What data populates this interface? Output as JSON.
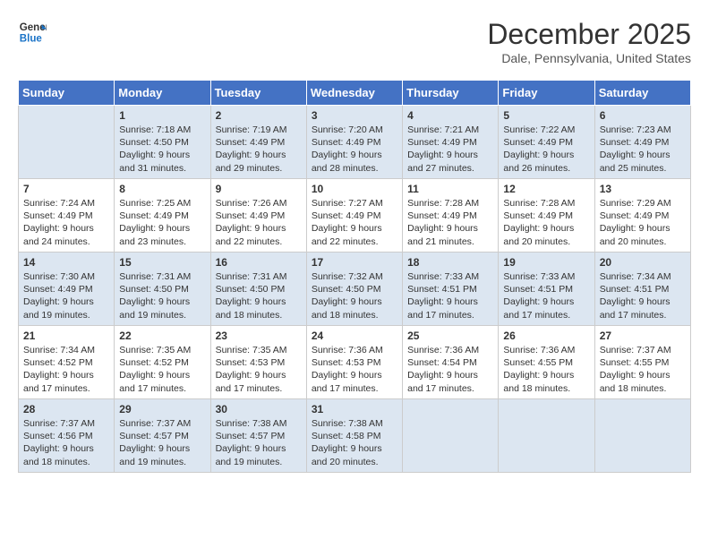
{
  "header": {
    "logo_line1": "General",
    "logo_line2": "Blue",
    "month": "December 2025",
    "location": "Dale, Pennsylvania, United States"
  },
  "days_of_week": [
    "Sunday",
    "Monday",
    "Tuesday",
    "Wednesday",
    "Thursday",
    "Friday",
    "Saturday"
  ],
  "weeks": [
    [
      {
        "day": "",
        "content": ""
      },
      {
        "day": "1",
        "content": "Sunrise: 7:18 AM\nSunset: 4:50 PM\nDaylight: 9 hours\nand 31 minutes."
      },
      {
        "day": "2",
        "content": "Sunrise: 7:19 AM\nSunset: 4:49 PM\nDaylight: 9 hours\nand 29 minutes."
      },
      {
        "day": "3",
        "content": "Sunrise: 7:20 AM\nSunset: 4:49 PM\nDaylight: 9 hours\nand 28 minutes."
      },
      {
        "day": "4",
        "content": "Sunrise: 7:21 AM\nSunset: 4:49 PM\nDaylight: 9 hours\nand 27 minutes."
      },
      {
        "day": "5",
        "content": "Sunrise: 7:22 AM\nSunset: 4:49 PM\nDaylight: 9 hours\nand 26 minutes."
      },
      {
        "day": "6",
        "content": "Sunrise: 7:23 AM\nSunset: 4:49 PM\nDaylight: 9 hours\nand 25 minutes."
      }
    ],
    [
      {
        "day": "7",
        "content": "Sunrise: 7:24 AM\nSunset: 4:49 PM\nDaylight: 9 hours\nand 24 minutes."
      },
      {
        "day": "8",
        "content": "Sunrise: 7:25 AM\nSunset: 4:49 PM\nDaylight: 9 hours\nand 23 minutes."
      },
      {
        "day": "9",
        "content": "Sunrise: 7:26 AM\nSunset: 4:49 PM\nDaylight: 9 hours\nand 22 minutes."
      },
      {
        "day": "10",
        "content": "Sunrise: 7:27 AM\nSunset: 4:49 PM\nDaylight: 9 hours\nand 22 minutes."
      },
      {
        "day": "11",
        "content": "Sunrise: 7:28 AM\nSunset: 4:49 PM\nDaylight: 9 hours\nand 21 minutes."
      },
      {
        "day": "12",
        "content": "Sunrise: 7:28 AM\nSunset: 4:49 PM\nDaylight: 9 hours\nand 20 minutes."
      },
      {
        "day": "13",
        "content": "Sunrise: 7:29 AM\nSunset: 4:49 PM\nDaylight: 9 hours\nand 20 minutes."
      }
    ],
    [
      {
        "day": "14",
        "content": "Sunrise: 7:30 AM\nSunset: 4:49 PM\nDaylight: 9 hours\nand 19 minutes."
      },
      {
        "day": "15",
        "content": "Sunrise: 7:31 AM\nSunset: 4:50 PM\nDaylight: 9 hours\nand 19 minutes."
      },
      {
        "day": "16",
        "content": "Sunrise: 7:31 AM\nSunset: 4:50 PM\nDaylight: 9 hours\nand 18 minutes."
      },
      {
        "day": "17",
        "content": "Sunrise: 7:32 AM\nSunset: 4:50 PM\nDaylight: 9 hours\nand 18 minutes."
      },
      {
        "day": "18",
        "content": "Sunrise: 7:33 AM\nSunset: 4:51 PM\nDaylight: 9 hours\nand 17 minutes."
      },
      {
        "day": "19",
        "content": "Sunrise: 7:33 AM\nSunset: 4:51 PM\nDaylight: 9 hours\nand 17 minutes."
      },
      {
        "day": "20",
        "content": "Sunrise: 7:34 AM\nSunset: 4:51 PM\nDaylight: 9 hours\nand 17 minutes."
      }
    ],
    [
      {
        "day": "21",
        "content": "Sunrise: 7:34 AM\nSunset: 4:52 PM\nDaylight: 9 hours\nand 17 minutes."
      },
      {
        "day": "22",
        "content": "Sunrise: 7:35 AM\nSunset: 4:52 PM\nDaylight: 9 hours\nand 17 minutes."
      },
      {
        "day": "23",
        "content": "Sunrise: 7:35 AM\nSunset: 4:53 PM\nDaylight: 9 hours\nand 17 minutes."
      },
      {
        "day": "24",
        "content": "Sunrise: 7:36 AM\nSunset: 4:53 PM\nDaylight: 9 hours\nand 17 minutes."
      },
      {
        "day": "25",
        "content": "Sunrise: 7:36 AM\nSunset: 4:54 PM\nDaylight: 9 hours\nand 17 minutes."
      },
      {
        "day": "26",
        "content": "Sunrise: 7:36 AM\nSunset: 4:55 PM\nDaylight: 9 hours\nand 18 minutes."
      },
      {
        "day": "27",
        "content": "Sunrise: 7:37 AM\nSunset: 4:55 PM\nDaylight: 9 hours\nand 18 minutes."
      }
    ],
    [
      {
        "day": "28",
        "content": "Sunrise: 7:37 AM\nSunset: 4:56 PM\nDaylight: 9 hours\nand 18 minutes."
      },
      {
        "day": "29",
        "content": "Sunrise: 7:37 AM\nSunset: 4:57 PM\nDaylight: 9 hours\nand 19 minutes."
      },
      {
        "day": "30",
        "content": "Sunrise: 7:38 AM\nSunset: 4:57 PM\nDaylight: 9 hours\nand 19 minutes."
      },
      {
        "day": "31",
        "content": "Sunrise: 7:38 AM\nSunset: 4:58 PM\nDaylight: 9 hours\nand 20 minutes."
      },
      {
        "day": "",
        "content": ""
      },
      {
        "day": "",
        "content": ""
      },
      {
        "day": "",
        "content": ""
      }
    ]
  ]
}
